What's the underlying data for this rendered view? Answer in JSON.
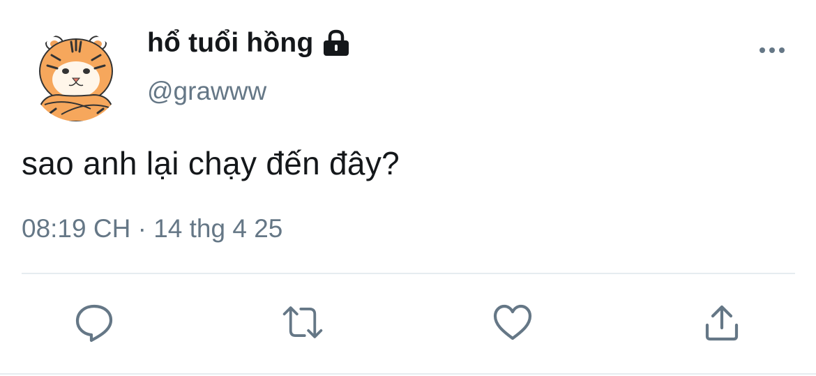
{
  "tweet": {
    "display_name": "hổ tuổi hồng",
    "handle": "@grawww",
    "text": "sao anh lại chạy đến đây?",
    "timestamp": "08:19 CH · 14 thg 4 25",
    "protected_icon": "lock-icon",
    "avatar": "tiger-illustration-avatar"
  },
  "actions": [
    {
      "icon": "reply-icon"
    },
    {
      "icon": "retweet-icon"
    },
    {
      "icon": "like-icon"
    },
    {
      "icon": "share-icon"
    }
  ],
  "colors": {
    "text_primary": "#14171a",
    "text_secondary": "#657786",
    "divider": "#e6ecf0"
  }
}
